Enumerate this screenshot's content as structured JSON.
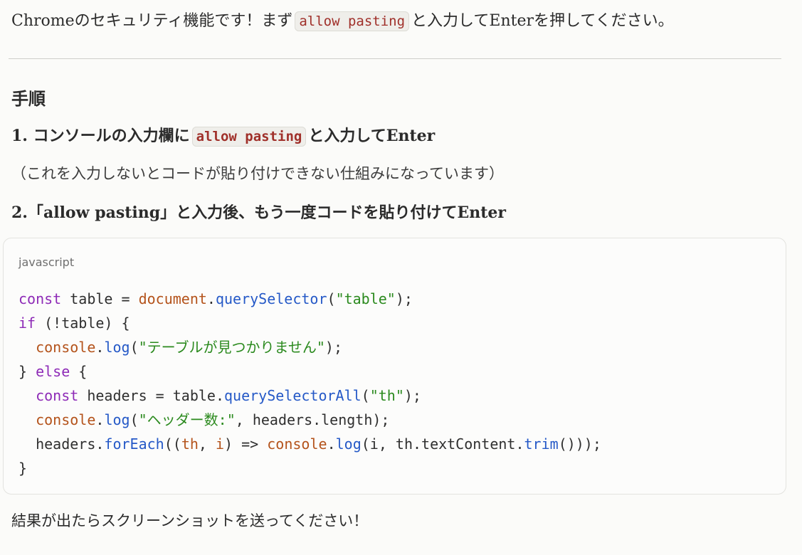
{
  "intro": {
    "before": "Chromeのセキュリティ機能です！まず",
    "code": "allow pasting",
    "after": "と入力してEnterを押してください。"
  },
  "section": {
    "heading": "手順"
  },
  "steps": [
    {
      "before": "1. コンソールの入力欄に",
      "code": "allow pasting",
      "after": "と入力してEnter"
    },
    {
      "text": "2.「allow pasting」と入力後、もう一度コードを貼り付けてEnter"
    }
  ],
  "note": "（これを入力しないとコードが貼り付けできない仕組みになっています）",
  "code_block": {
    "language": "javascript",
    "lines": [
      [
        {
          "t": "kw",
          "v": "const"
        },
        {
          "t": "p",
          "v": " table = "
        },
        {
          "t": "obj",
          "v": "document"
        },
        {
          "t": "p",
          "v": "."
        },
        {
          "t": "fn",
          "v": "querySelector"
        },
        {
          "t": "p",
          "v": "("
        },
        {
          "t": "str",
          "v": "\"table\""
        },
        {
          "t": "p",
          "v": ");"
        }
      ],
      [
        {
          "t": "kw",
          "v": "if"
        },
        {
          "t": "p",
          "v": " (!table) {"
        }
      ],
      [
        {
          "t": "p",
          "v": "  "
        },
        {
          "t": "obj",
          "v": "console"
        },
        {
          "t": "p",
          "v": "."
        },
        {
          "t": "fn",
          "v": "log"
        },
        {
          "t": "p",
          "v": "("
        },
        {
          "t": "str",
          "v": "\"テーブルが見つかりません\""
        },
        {
          "t": "p",
          "v": ");"
        }
      ],
      [
        {
          "t": "p",
          "v": "} "
        },
        {
          "t": "kw",
          "v": "else"
        },
        {
          "t": "p",
          "v": " {"
        }
      ],
      [
        {
          "t": "p",
          "v": "  "
        },
        {
          "t": "kw",
          "v": "const"
        },
        {
          "t": "p",
          "v": " headers = table."
        },
        {
          "t": "fn",
          "v": "querySelectorAll"
        },
        {
          "t": "p",
          "v": "("
        },
        {
          "t": "str",
          "v": "\"th\""
        },
        {
          "t": "p",
          "v": ");"
        }
      ],
      [
        {
          "t": "p",
          "v": "  "
        },
        {
          "t": "obj",
          "v": "console"
        },
        {
          "t": "p",
          "v": "."
        },
        {
          "t": "fn",
          "v": "log"
        },
        {
          "t": "p",
          "v": "("
        },
        {
          "t": "str",
          "v": "\"ヘッダー数:\""
        },
        {
          "t": "p",
          "v": ", headers.length);"
        }
      ],
      [
        {
          "t": "p",
          "v": "  headers."
        },
        {
          "t": "fn",
          "v": "forEach"
        },
        {
          "t": "p",
          "v": "(("
        },
        {
          "t": "obj",
          "v": "th"
        },
        {
          "t": "p",
          "v": ", "
        },
        {
          "t": "obj",
          "v": "i"
        },
        {
          "t": "p",
          "v": ") => "
        },
        {
          "t": "obj",
          "v": "console"
        },
        {
          "t": "p",
          "v": "."
        },
        {
          "t": "fn",
          "v": "log"
        },
        {
          "t": "p",
          "v": "(i, th.textContent."
        },
        {
          "t": "fn",
          "v": "trim"
        },
        {
          "t": "p",
          "v": "()));"
        }
      ],
      [
        {
          "t": "p",
          "v": "}"
        }
      ]
    ]
  },
  "outro": "結果が出たらスクリーンショットを送ってください！",
  "colors": {
    "keyword": "#8e2bb7",
    "object": "#b4531b",
    "function": "#2559c7",
    "string": "#2b8a1e",
    "inline_code": "#a0302a"
  }
}
